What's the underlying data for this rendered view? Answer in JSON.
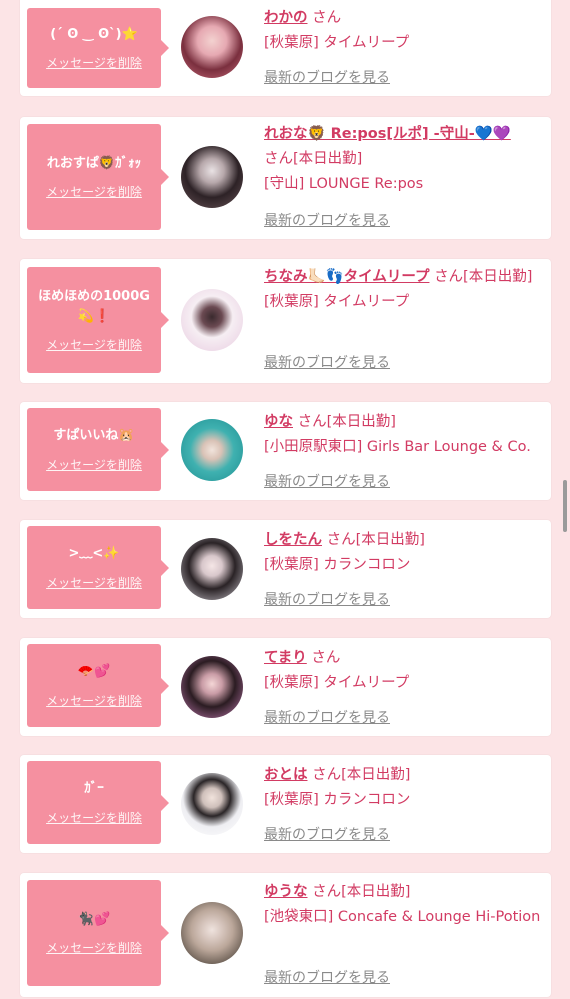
{
  "delete_label": "メッセージを削除",
  "blog_label": "最新のブログを見る",
  "cards": [
    {
      "message": "(´ ʘ ‿ ʘ`)⭐",
      "name": "わかの",
      "suffix": "さん",
      "shop": "[秋葉原] タイムリープ"
    },
    {
      "message": "れおすぱ🦁ｶﾞｫｯ",
      "name": "れおな🦁 Re:pos[ルポ] -守山-💙💜",
      "suffix": "さん[本日出勤]",
      "shop": "[守山] LOUNGE Re:pos"
    },
    {
      "message": "ほめほめの1000G💫❗",
      "name": "ちなみ🦶🏻👣タイムリープ",
      "suffix": "さん[本日出勤]",
      "shop": "[秋葉原] タイムリープ"
    },
    {
      "message": "すぱいいね🐹",
      "name": "ゆな",
      "suffix": "さん[本日出勤]",
      "shop": "[小田原駅東口] Girls Bar Lounge & Co."
    },
    {
      "message": ">﹏<✨",
      "name": "しをたん",
      "suffix": "さん[本日出勤]",
      "shop": "[秋葉原] カランコロン"
    },
    {
      "message": "🪭💕",
      "name": "てまり",
      "suffix": "さん",
      "shop": "[秋葉原] タイムリープ"
    },
    {
      "message": "ｶﾞｰ",
      "name": "おとは",
      "suffix": "さん[本日出勤]",
      "shop": "[秋葉原] カランコロン"
    },
    {
      "message": "🐈‍⬛💕",
      "name": "ゆうな",
      "suffix": "さん[本日出勤]",
      "shop": "[池袋東口] Concafe & Lounge Hi-Potion"
    }
  ],
  "colors": {
    "accent": "#d23b63",
    "bubble": "#f590a0",
    "background": "#fce4e6"
  }
}
